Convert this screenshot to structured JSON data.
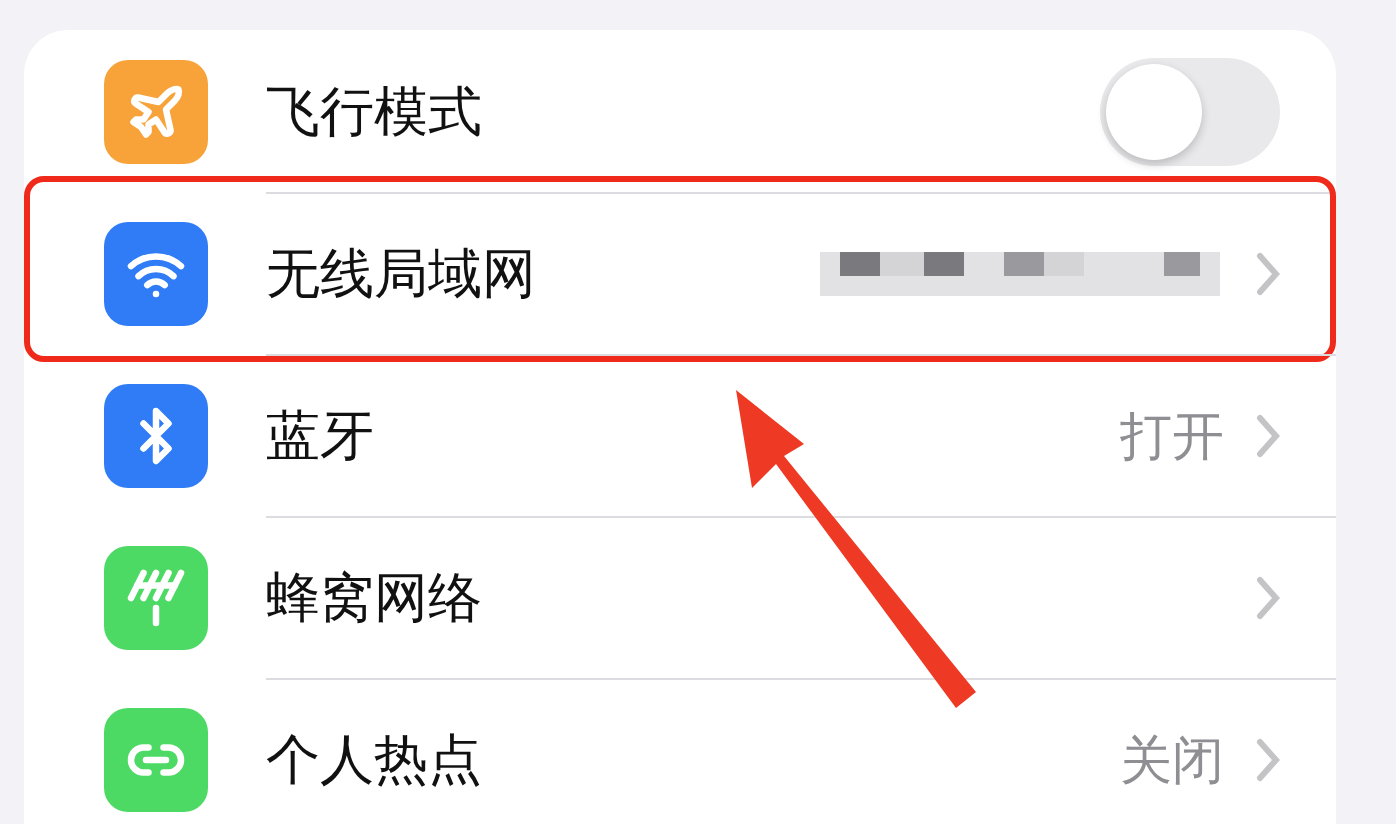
{
  "settings_rows": [
    {
      "label": "飞行模式",
      "kind": "toggle",
      "on": false,
      "color": "#f7a33a",
      "highlighted": false
    },
    {
      "label": "无线局域网",
      "kind": "redacted",
      "color": "#2f7cf6",
      "highlighted": true
    },
    {
      "label": "蓝牙",
      "kind": "detail",
      "value": "打开",
      "color": "#2f7cf6",
      "highlighted": false
    },
    {
      "label": "蜂窝网络",
      "kind": "detail",
      "color": "#4cd964",
      "highlighted": false
    },
    {
      "label": "个人热点",
      "kind": "detail",
      "value": "关闭",
      "color": "#4cd964",
      "highlighted": false
    }
  ]
}
